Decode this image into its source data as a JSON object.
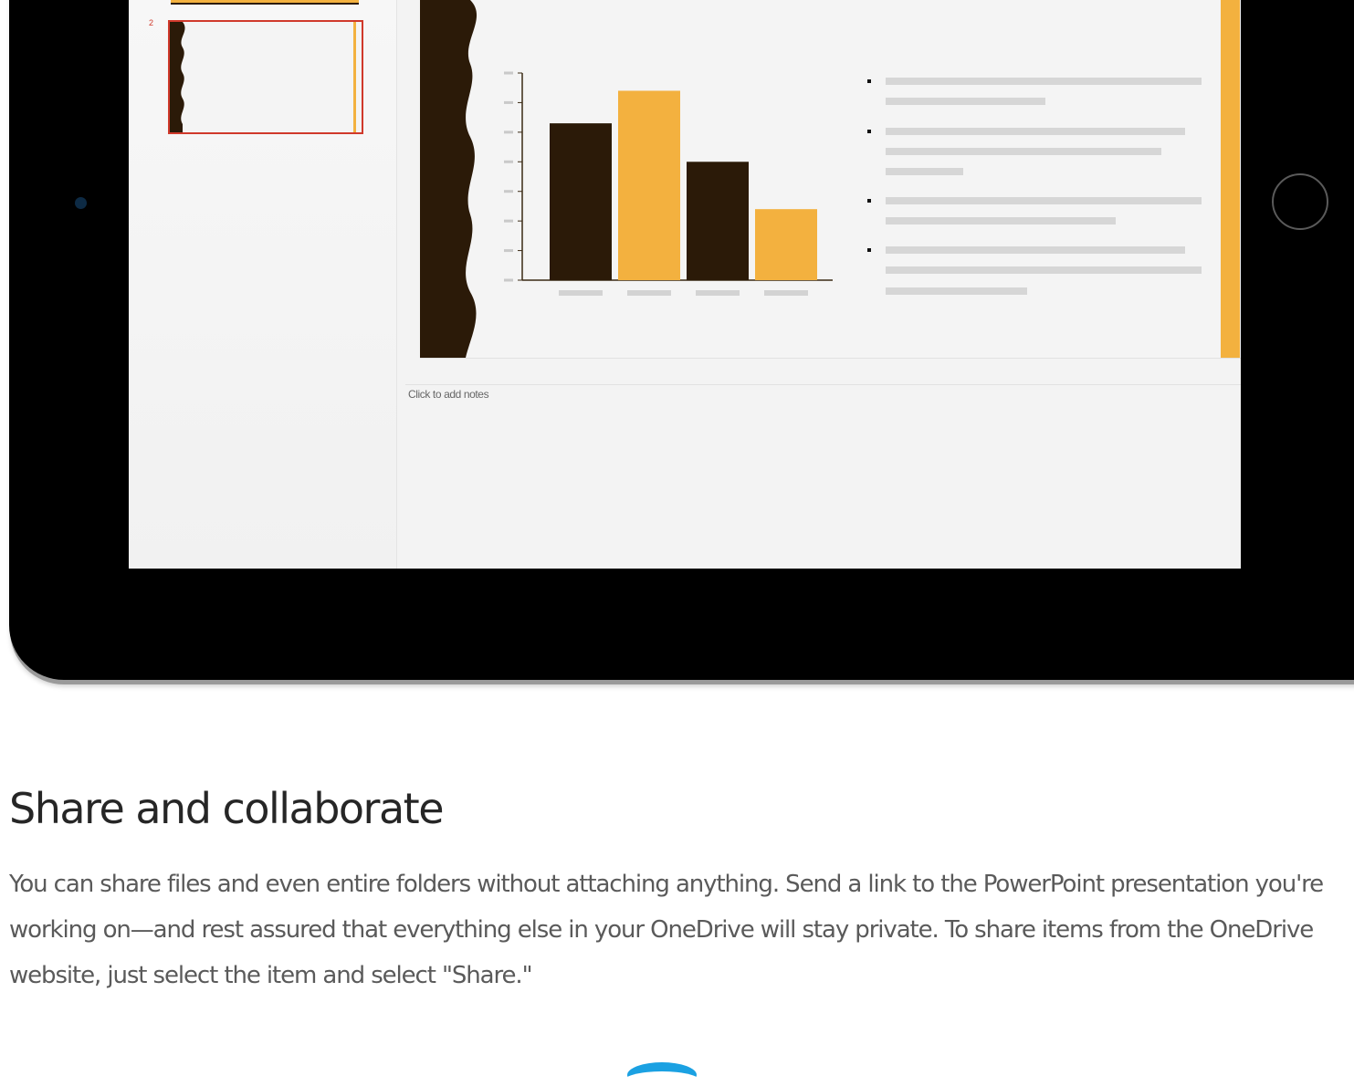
{
  "editor": {
    "thumbnail_number": "2",
    "notes_placeholder": "Click to add notes"
  },
  "colors": {
    "accent": "#f3b13f",
    "dark_brown": "#2b1a08",
    "selection": "#d0392b"
  },
  "chart_data": {
    "type": "bar",
    "categories": [
      "",
      "",
      "",
      ""
    ],
    "values": [
      53,
      64,
      40,
      24
    ],
    "colors": [
      "#2b1a08",
      "#f3b13f",
      "#2b1a08",
      "#f3b13f"
    ],
    "ylim": [
      0,
      70
    ],
    "yticks": [
      0,
      10,
      20,
      30,
      40,
      50,
      60,
      70
    ],
    "grid": false,
    "title": "",
    "xlabel": "",
    "ylabel": ""
  },
  "section": {
    "title": "Share and collaborate",
    "body": "You can share files and even entire folders without attaching anything. Send a link to the PowerPoint presentation you're working on—and rest assured that everything else in your OneDrive will stay private. To share items from the OneDrive website, just select the item and select \"Share.\""
  },
  "icons": {
    "logo": "onedrive-cloud-icon",
    "home": "home-button-icon",
    "camera": "front-camera-icon"
  }
}
